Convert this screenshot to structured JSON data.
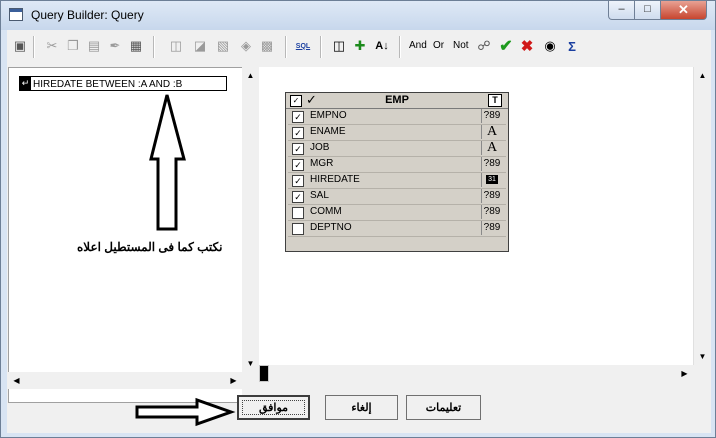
{
  "window": {
    "title": "Query Builder: Query",
    "min_glyph": "‒",
    "max_glyph": "□",
    "close_glyph": "✕"
  },
  "toolbar": {
    "and_label": "And",
    "or_label": "Or",
    "not_label": "Not",
    "sql_label": "SQL"
  },
  "condition": {
    "icon_glyph": "↵",
    "text": "HIREDATE BETWEEN :A  AND :B"
  },
  "annotation": {
    "text": "نكتب كما فى المستطيل اعلاه"
  },
  "table": {
    "name": "EMP",
    "header_check": "✓",
    "header_type": "T",
    "columns": [
      {
        "name": "EMPNO",
        "checked": "✓",
        "type": "?89"
      },
      {
        "name": "ENAME",
        "checked": "✓",
        "type": "A"
      },
      {
        "name": "JOB",
        "checked": "✓",
        "type": "A"
      },
      {
        "name": "MGR",
        "checked": "✓",
        "type": "?89"
      },
      {
        "name": "HIREDATE",
        "checked": "✓",
        "type": "31"
      },
      {
        "name": "SAL",
        "checked": "✓",
        "type": "?89"
      },
      {
        "name": "COMM",
        "checked": "",
        "type": "?89"
      },
      {
        "name": "DEPTNO",
        "checked": "",
        "type": "?89"
      }
    ]
  },
  "buttons": {
    "ok": "موافق",
    "cancel": "إلغاء",
    "help": "تعليمات"
  },
  "scroll": {
    "up": "▲",
    "down": "▼",
    "left": "◀",
    "right": "▶"
  }
}
